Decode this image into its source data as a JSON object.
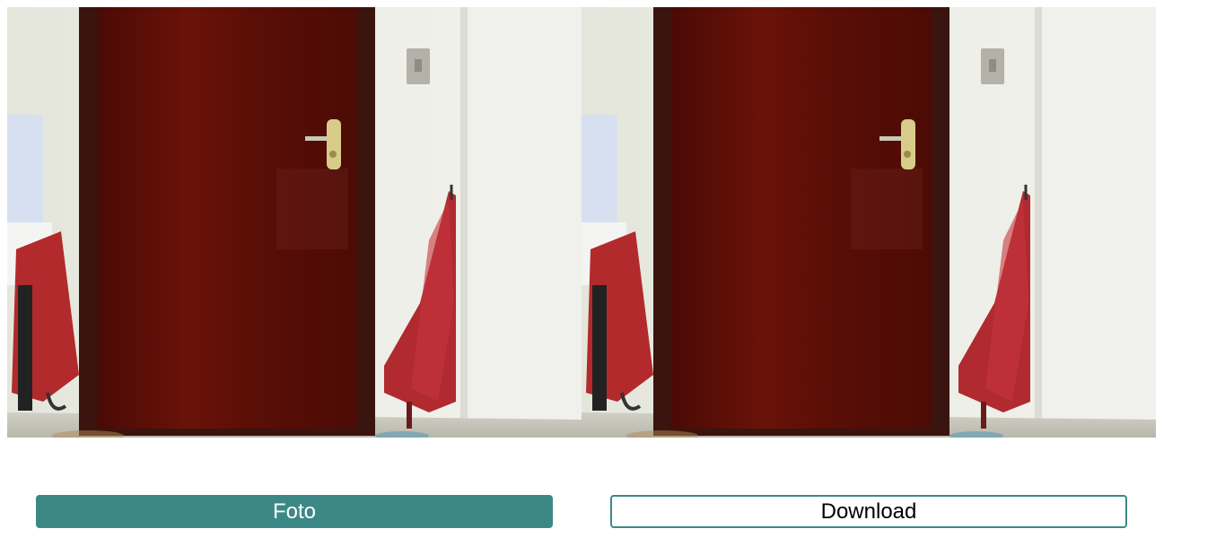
{
  "video": {
    "name": "webcam-live-preview"
  },
  "canvas": {
    "name": "captured-photo"
  },
  "buttons": {
    "foto_label": "Foto",
    "download_label": "Download"
  },
  "colors": {
    "accent": "#3c8887",
    "wall": "#eceee6",
    "door": "#5e0e07",
    "door_frame": "#3a140e",
    "umbrella": "#b02a30"
  }
}
